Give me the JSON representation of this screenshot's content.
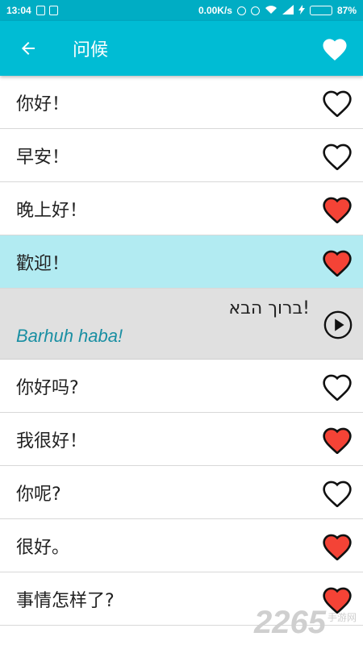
{
  "status_bar": {
    "time": "13:04",
    "network_speed": "0.00K/s",
    "battery_percent": "87%",
    "battery_level": 0.87
  },
  "header": {
    "title": "问候",
    "back_icon": "arrow-left-icon",
    "favorite_icon": "heart-filled-icon"
  },
  "colors": {
    "primary": "#00bcd4",
    "status_bar": "#00adc4",
    "selected_row": "#b2ebf2",
    "expanded_row": "#e0e0e0",
    "heart_red": "#f44336",
    "translit": "#1a8fa3"
  },
  "phrases": [
    {
      "text": "你好！",
      "favorite": false
    },
    {
      "text": "早安！",
      "favorite": false
    },
    {
      "text": "晚上好！",
      "favorite": true
    },
    {
      "text": "歡迎！",
      "favorite": true,
      "selected": true
    },
    {
      "text": "你好吗?",
      "favorite": false
    },
    {
      "text": "我很好！",
      "favorite": true
    },
    {
      "text": "你呢?",
      "favorite": false
    },
    {
      "text": "很好。",
      "favorite": true
    },
    {
      "text": "事情怎样了?",
      "favorite": true
    }
  ],
  "expanded": {
    "foreign_text": "!ברוך הבא",
    "transliteration": "Barhuh haba!",
    "play_icon": "play-circle-icon"
  },
  "watermark": {
    "brand": "2265",
    "sub": "手游网"
  }
}
